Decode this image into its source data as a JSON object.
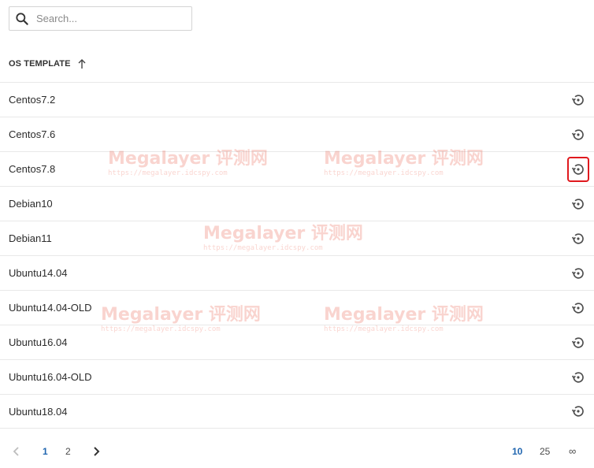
{
  "search": {
    "placeholder": "Search..."
  },
  "table": {
    "column_header": "OS TEMPLATE",
    "sort": "ascending",
    "rows": [
      {
        "name": "Centos7.2"
      },
      {
        "name": "Centos7.6"
      },
      {
        "name": "Centos7.8",
        "highlighted": true
      },
      {
        "name": "Debian10"
      },
      {
        "name": "Debian11"
      },
      {
        "name": "Ubuntu14.04"
      },
      {
        "name": "Ubuntu14.04-OLD"
      },
      {
        "name": "Ubuntu16.04"
      },
      {
        "name": "Ubuntu16.04-OLD"
      },
      {
        "name": "Ubuntu18.04"
      }
    ],
    "row_action_icon": "restore-icon"
  },
  "pagination": {
    "pages": [
      "1",
      "2"
    ],
    "current_page": "1",
    "page_sizes": [
      "10",
      "25",
      "∞"
    ],
    "current_page_size": "10"
  },
  "watermark": {
    "title": "Megalayer 评测网",
    "url": "https://megalayer.idcspy.com"
  },
  "colors": {
    "accent": "#2166b0",
    "highlight": "#e0191e",
    "border": "#e8e8e8"
  }
}
